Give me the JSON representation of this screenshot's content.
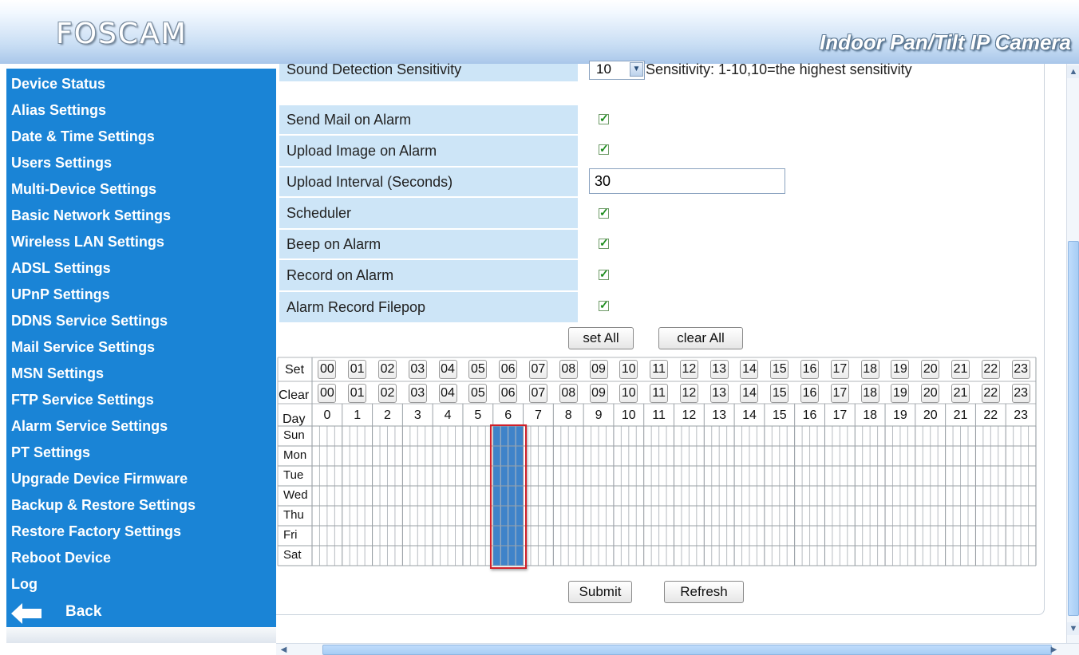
{
  "header": {
    "logo": "FOSCAM",
    "product": "Indoor Pan/Tilt IP Camera"
  },
  "sidebar": {
    "items": [
      {
        "label": "Device Status"
      },
      {
        "label": "Alias Settings"
      },
      {
        "label": "Date & Time Settings"
      },
      {
        "label": "Users Settings"
      },
      {
        "label": "Multi-Device Settings"
      },
      {
        "label": "Basic Network Settings"
      },
      {
        "label": "Wireless LAN Settings"
      },
      {
        "label": "ADSL Settings"
      },
      {
        "label": "UPnP Settings"
      },
      {
        "label": "DDNS Service Settings"
      },
      {
        "label": "Mail Service Settings"
      },
      {
        "label": "MSN Settings"
      },
      {
        "label": "FTP Service Settings"
      },
      {
        "label": "Alarm Service Settings"
      },
      {
        "label": "PT Settings"
      },
      {
        "label": "Upgrade Device Firmware"
      },
      {
        "label": "Backup & Restore Settings"
      },
      {
        "label": "Restore Factory Settings"
      },
      {
        "label": "Reboot Device"
      },
      {
        "label": "Log"
      }
    ],
    "back_label": "Back"
  },
  "form": {
    "sound_sensitivity_label": "Sound Detection Sensitivity",
    "sound_sensitivity_value": "10",
    "sound_sensitivity_hint": "Sensitivity: 1-10,10=the highest sensitivity",
    "send_mail_label": "Send Mail on Alarm",
    "send_mail_checked": true,
    "upload_image_label": "Upload Image on Alarm",
    "upload_image_checked": true,
    "upload_interval_label": "Upload Interval (Seconds)",
    "upload_interval_value": "30",
    "scheduler_label": "Scheduler",
    "scheduler_checked": true,
    "beep_label": "Beep on Alarm",
    "beep_checked": true,
    "record_label": "Record on Alarm",
    "record_checked": true,
    "filepop_label": "Alarm Record Filepop",
    "filepop_checked": true,
    "set_all_label": "set All",
    "clear_all_label": "clear All"
  },
  "schedule": {
    "set_label": "Set",
    "clear_label": "Clear",
    "day_label": "Day",
    "hour_buttons": [
      "00",
      "01",
      "02",
      "03",
      "04",
      "05",
      "06",
      "07",
      "08",
      "09",
      "10",
      "11",
      "12",
      "13",
      "14",
      "15",
      "16",
      "17",
      "18",
      "19",
      "20",
      "21",
      "22",
      "23"
    ],
    "hour_numbers": [
      "0",
      "1",
      "2",
      "3",
      "4",
      "5",
      "6",
      "7",
      "8",
      "9",
      "10",
      "11",
      "12",
      "13",
      "14",
      "15",
      "16",
      "17",
      "18",
      "19",
      "20",
      "21",
      "22",
      "23"
    ],
    "days": [
      "Sun",
      "Mon",
      "Tue",
      "Wed",
      "Thu",
      "Fri",
      "Sat"
    ],
    "selected_hours": [
      6
    ],
    "selected_color": "#3f83c9",
    "highlight_color": "#d0202a"
  },
  "actions": {
    "submit_label": "Submit",
    "refresh_label": "Refresh"
  },
  "colors": {
    "sidebar_bg": "#1a84d6",
    "label_bg": "#cde5f7"
  }
}
